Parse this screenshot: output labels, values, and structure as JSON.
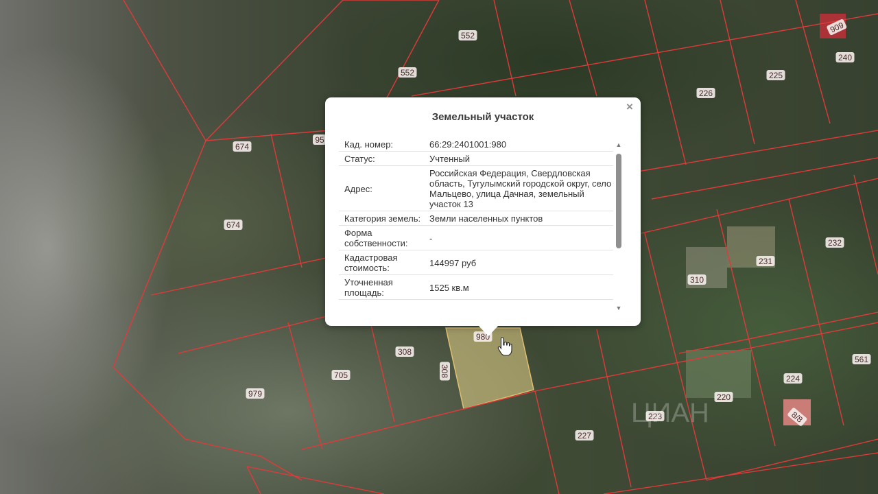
{
  "map": {
    "plots": [
      {
        "id": "p1",
        "label": "552",
        "color": "#4a2a2a"
      },
      {
        "id": "p2",
        "label": "552",
        "color": "#4a2a2a"
      },
      {
        "id": "p3",
        "label": "909",
        "color": "#4a2a2a"
      },
      {
        "id": "p4",
        "label": "240",
        "color": "#4a2a2a"
      },
      {
        "id": "p5",
        "label": "225",
        "color": "#4a2a2a"
      },
      {
        "id": "p6",
        "label": "226",
        "color": "#4a2a2a"
      },
      {
        "id": "p7",
        "label": "674",
        "color": "#4a2a2a"
      },
      {
        "id": "p8",
        "label": "95",
        "color": "#4a2a2a"
      },
      {
        "id": "p9",
        "label": "674",
        "color": "#4a2a2a"
      },
      {
        "id": "p10",
        "label": "232",
        "color": "#4a2a2a"
      },
      {
        "id": "p11",
        "label": "231",
        "color": "#4a2a2a"
      },
      {
        "id": "p12",
        "label": "310",
        "color": "#4a2a2a"
      },
      {
        "id": "p13",
        "label": "980",
        "color": "#4a2a2a"
      },
      {
        "id": "p14",
        "label": "308",
        "color": "#4a2a2a"
      },
      {
        "id": "p15",
        "label": "308",
        "color": "#4a2a2a"
      },
      {
        "id": "p16",
        "label": "705",
        "color": "#4a2a2a"
      },
      {
        "id": "p17",
        "label": "979",
        "color": "#4a2a2a"
      },
      {
        "id": "p18",
        "label": "561",
        "color": "#4a2a2a"
      },
      {
        "id": "p19",
        "label": "224",
        "color": "#4a2a2a"
      },
      {
        "id": "p20",
        "label": "220",
        "color": "#4a2a2a"
      },
      {
        "id": "p21",
        "label": "223",
        "color": "#4a2a2a"
      },
      {
        "id": "p22",
        "label": "227",
        "color": "#4a2a2a"
      },
      {
        "id": "p23",
        "label": "8/8",
        "color": "#4a2a2a"
      }
    ],
    "boundary_color": "#e03a3a",
    "selected_fill": "#e8d48a",
    "watermark": "ЦИАН"
  },
  "popup": {
    "title": "Земельный участок",
    "close_symbol": "×",
    "rows": [
      {
        "key": "Кад. номер:",
        "value": "66:29:2401001:980"
      },
      {
        "key": "Статус:",
        "value": "Учтенный"
      },
      {
        "key": "Адрес:",
        "value": "Российская Федерация, Свердловская область, Тугулымский городской округ, село Мальцево, улица Дачная, земельный участок 13"
      },
      {
        "key": "Категория земель:",
        "value": "Земли населенных пунктов"
      },
      {
        "key": "Форма собственности:",
        "value": "-"
      },
      {
        "key": "Кадастровая стоимость:",
        "value": "144997 руб"
      },
      {
        "key": "Уточненная площадь:",
        "value": "1525 кв.м"
      }
    ]
  }
}
